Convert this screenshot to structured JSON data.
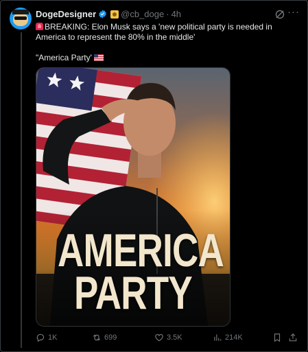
{
  "post": {
    "display_name": "DogeDesigner",
    "handle": "@cb_doge",
    "separator": "·",
    "time": "4h",
    "text": "BREAKING: Elon Musk says a 'new political party is needed in America to represent the 80% in the middle'",
    "quote": "\"America Party'",
    "image_text": {
      "line1": "AMERICA",
      "line2": "PARTY"
    }
  },
  "actions": {
    "replies": "1K",
    "reposts": "699",
    "likes": "3.5K",
    "views": "214K"
  },
  "colors": {
    "background": "#000000",
    "text": "#e7e9ea",
    "muted": "#71767b",
    "verified": "#1d9bf0"
  },
  "icons": [
    "grok-icon",
    "more-icon",
    "reply-icon",
    "repost-icon",
    "like-icon",
    "views-icon",
    "bookmark-icon",
    "share-icon",
    "siren-icon",
    "us-flag-icon",
    "verified-badge-icon"
  ]
}
